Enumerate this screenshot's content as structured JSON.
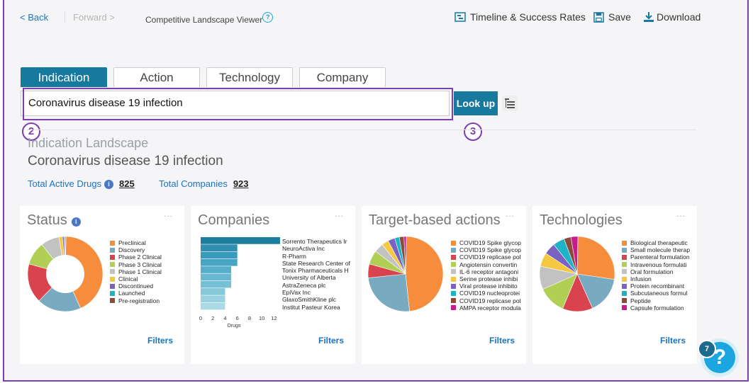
{
  "nav": {
    "back": "< Back",
    "forward": "Forward >",
    "app_title": "Competitive Landscape Viewer",
    "help_mini": "?"
  },
  "toolbar": {
    "timeline": "Timeline & Success Rates",
    "save": "Save",
    "download": "Download"
  },
  "tabs": [
    {
      "label": "Indication",
      "active": true
    },
    {
      "label": "Action"
    },
    {
      "label": "Technology"
    },
    {
      "label": "Company"
    }
  ],
  "search": {
    "value": "Coronavirus disease 19 infection",
    "button": "Look up"
  },
  "annotations": {
    "two": "2",
    "three": "3"
  },
  "landscape": {
    "heading": "Indication Landscape",
    "subject": "Coronavirus disease 19 infection",
    "active_drugs_label": "Total Active Drugs",
    "active_drugs_value": "825",
    "companies_label": "Total Companies",
    "companies_value": "923",
    "info_glyph": "i"
  },
  "cards": {
    "status": {
      "title": "Status",
      "dots": "...",
      "filters": "Filters",
      "legend": [
        {
          "label": "Preclinical",
          "color": "#f58d3c"
        },
        {
          "label": "Discovery",
          "color": "#78aac2"
        },
        {
          "label": "Phase 2 Clinical",
          "color": "#d9434d"
        },
        {
          "label": "Phase 3 Clinical",
          "color": "#b2cf55"
        },
        {
          "label": "Phase 1 Clinical",
          "color": "#c2c2c2"
        },
        {
          "label": "Clinical",
          "color": "#f5c842"
        },
        {
          "label": "Discontinued",
          "color": "#7a62c2"
        },
        {
          "label": "Launched",
          "color": "#1fb3c8"
        },
        {
          "label": "Pre-registration",
          "color": "#8c4b38"
        }
      ]
    },
    "companies": {
      "title": "Companies",
      "dots": "...",
      "filters": "Filters",
      "companies": [
        "Sorrento Therapeutics Ir",
        "NeuroActiva Inc",
        "R-Pharm",
        "State Research Center of",
        "Tonix Pharmaceuticals H",
        "University of Alberta",
        "AstraZeneca plc",
        "EpiVax Inc",
        "GlaxoSmithKline plc",
        "Institut Pasteur Korea"
      ],
      "axis_ticks": [
        "0",
        "2",
        "4",
        "6",
        "8",
        "10",
        "12"
      ],
      "axis_label": "Drugs"
    },
    "targets": {
      "title": "Target-based actions",
      "dots": "...",
      "filters": "Filters",
      "legend": [
        {
          "label": "COVID19 Spike glycop",
          "color": "#f58d3c"
        },
        {
          "label": "COVID19 Spike glycop",
          "color": "#78aac2"
        },
        {
          "label": "COVID19 replicase pol",
          "color": "#d9434d"
        },
        {
          "label": "Angiotensin convertin",
          "color": "#b2cf55"
        },
        {
          "label": "IL-6 receptor antagoni",
          "color": "#c2c2c2"
        },
        {
          "label": "Serine protease inhibi",
          "color": "#f5c842"
        },
        {
          "label": "Viral protease inhibito",
          "color": "#7a62c2"
        },
        {
          "label": "COVID19 nucleoprotei",
          "color": "#1fb3c8"
        },
        {
          "label": "COVID19 replicase pol",
          "color": "#8c4b38"
        },
        {
          "label": "AMPA receptor modula",
          "color": "#c81c8c"
        }
      ]
    },
    "technologies": {
      "title": "Technologies",
      "dots": "...",
      "filters": "Filters",
      "legend": [
        {
          "label": "Biological therapeutic",
          "color": "#f58d3c"
        },
        {
          "label": "Small molecule therap",
          "color": "#78aac2"
        },
        {
          "label": "Parenteral formulation",
          "color": "#d9434d"
        },
        {
          "label": "Intravenous formulati",
          "color": "#b2cf55"
        },
        {
          "label": "Oral formulation",
          "color": "#c2c2c2"
        },
        {
          "label": "Infusion",
          "color": "#f5c842"
        },
        {
          "label": "Protein recombinant",
          "color": "#7a62c2"
        },
        {
          "label": "Subcutaneous formul",
          "color": "#1fb3c8"
        },
        {
          "label": "Peptide",
          "color": "#8c4b38"
        },
        {
          "label": "Capsule formulation",
          "color": "#c81c8c"
        }
      ]
    }
  },
  "help": {
    "badge": "7",
    "glyph": "?"
  },
  "chart_data": [
    {
      "type": "pie",
      "title": "Status",
      "labels": [
        "Preclinical",
        "Discovery",
        "Phase 2 Clinical",
        "Phase 3 Clinical",
        "Phase 1 Clinical",
        "Clinical",
        "Discontinued",
        "Launched",
        "Pre-registration"
      ],
      "values": [
        43,
        19,
        17,
        10,
        8,
        1.5,
        0.7,
        0.5,
        0.3
      ]
    },
    {
      "type": "bar",
      "title": "Companies",
      "orientation": "horizontal",
      "categories": [
        "Sorrento Therapeutics Ir",
        "NeuroActiva Inc",
        "R-Pharm",
        "State Research Center of",
        "Tonix Pharmaceuticals H",
        "University of Alberta",
        "AstraZeneca plc",
        "EpiVax Inc",
        "GlaxoSmithKline plc",
        "Institut Pasteur Korea"
      ],
      "values": [
        13,
        6,
        6,
        6,
        5,
        5,
        5,
        4,
        4,
        4
      ],
      "xlabel": "Drugs",
      "xlim": [
        0,
        13
      ]
    },
    {
      "type": "pie",
      "title": "Target-based actions",
      "labels": [
        "COVID19 Spike glycop",
        "COVID19 Spike glycop",
        "COVID19 replicase pol",
        "Angiotensin convertin",
        "IL-6 receptor antagoni",
        "Serine protease inhibi",
        "Viral protease inhibito",
        "COVID19 nucleoprotei",
        "COVID19 replicase pol",
        "AMPA receptor modula"
      ],
      "values": [
        48,
        25,
        6,
        6,
        4,
        3,
        3,
        2,
        2,
        1
      ]
    },
    {
      "type": "pie",
      "title": "Technologies",
      "labels": [
        "Biological therapeutic",
        "Small molecule therap",
        "Parenteral formulation",
        "Intravenous formulati",
        "Oral formulation",
        "Infusion",
        "Protein recombinant",
        "Subcutaneous formul",
        "Peptide",
        "Capsule formulation"
      ],
      "values": [
        27,
        16,
        13,
        12,
        10,
        6,
        5,
        5,
        3,
        3
      ]
    }
  ]
}
